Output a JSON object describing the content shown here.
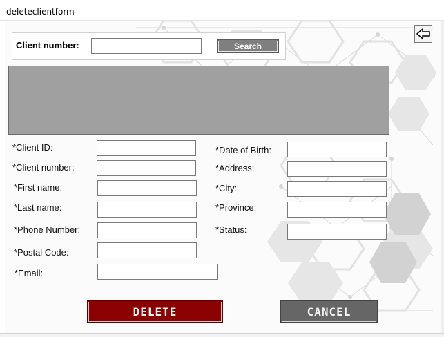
{
  "window": {
    "title": "deleteclientform"
  },
  "search": {
    "label": "Client number:",
    "input_value": "",
    "button_label": "Search"
  },
  "fields": {
    "client_id": {
      "label": "*Client ID:",
      "value": ""
    },
    "client_number": {
      "label": "*Client number:",
      "value": ""
    },
    "first_name": {
      "label": "*First name:",
      "value": ""
    },
    "last_name": {
      "label": "*Last name:",
      "value": ""
    },
    "phone_number": {
      "label": "*Phone Number:",
      "value": ""
    },
    "postal_code": {
      "label": "*Postal Code:",
      "value": ""
    },
    "email": {
      "label": "*Email:",
      "value": ""
    },
    "date_of_birth": {
      "label": "*Date of Birth:",
      "value": ""
    },
    "address": {
      "label": "*Address:",
      "value": ""
    },
    "city": {
      "label": "*City:",
      "value": ""
    },
    "province": {
      "label": "*Province:",
      "value": ""
    },
    "status": {
      "label": "*Status:",
      "value": ""
    }
  },
  "buttons": {
    "delete": "DELETE",
    "cancel": "CANCEL"
  },
  "icons": {
    "back": "back-arrow-icon"
  },
  "colors": {
    "delete_button": "#8b0000",
    "cancel_button": "#666666",
    "search_button": "#7f7f7f",
    "grid_background": "#a0a0a0"
  }
}
